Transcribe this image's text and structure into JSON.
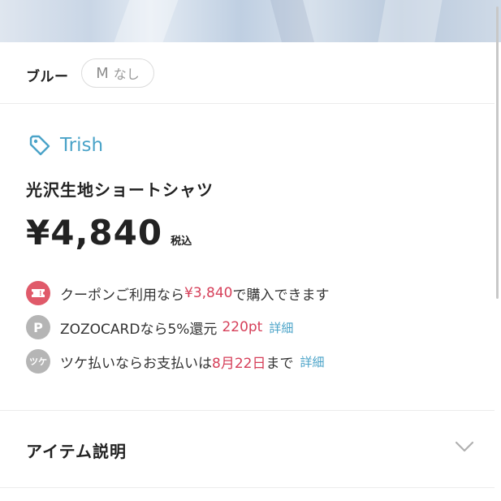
{
  "variant": {
    "color": "ブルー",
    "size_letter": "M",
    "size_status": "なし"
  },
  "brand": {
    "name": "Trish",
    "icon": "tag-icon"
  },
  "product": {
    "name": "光沢生地ショートシャツ",
    "price": "¥4,840",
    "tax_label": "税込"
  },
  "offers": {
    "coupon": {
      "icon": "coupon-ticket-icon",
      "prefix": "クーポンご利用なら",
      "price": "¥3,840",
      "suffix": "で購入できます"
    },
    "points": {
      "icon": "point-icon",
      "icon_text": "P",
      "prefix": "ZOZOCARDなら5%還元 ",
      "points": "220pt",
      "link": "詳細"
    },
    "tsuke": {
      "icon": "tsuke-icon",
      "icon_text": "ツケ",
      "prefix": "ツケ払いならお支払いは",
      "date": "8月22日",
      "suffix": "まで",
      "link": "詳細"
    }
  },
  "item_description": {
    "label": "アイテム説明",
    "icon": "chevron-down-icon"
  },
  "colors": {
    "accent_blue": "#4aa3c8",
    "price_red": "#d6405a",
    "coupon_icon_bg": "#e05a6a"
  }
}
